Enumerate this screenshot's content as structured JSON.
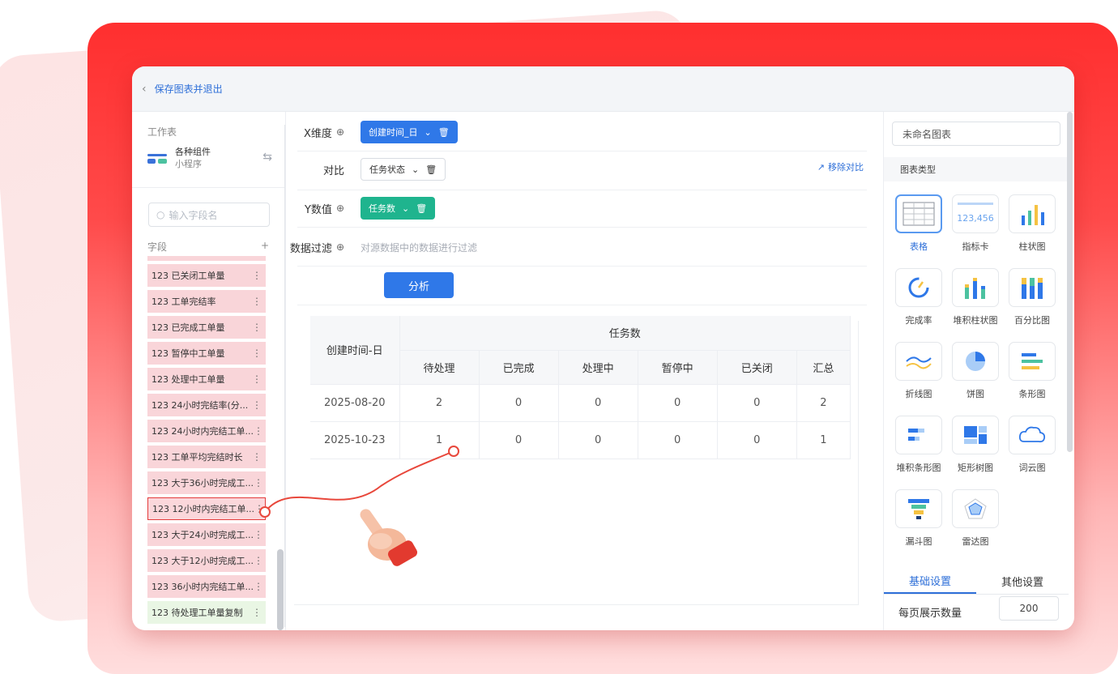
{
  "topbar": {
    "back_label": "保存图表并退出"
  },
  "left": {
    "workspace_title": "工作表",
    "workspace_name": "各种组件",
    "workspace_type": "小程序",
    "search_placeholder": "输入字段名",
    "field_header": "字段",
    "fields": [
      {
        "label": "123 已关闭工单量",
        "color": "pink"
      },
      {
        "label": "123 工单完结率",
        "color": "pink"
      },
      {
        "label": "123 已完成工单量",
        "color": "pink"
      },
      {
        "label": "123 暂停中工单量",
        "color": "pink"
      },
      {
        "label": "123 处理中工单量",
        "color": "pink"
      },
      {
        "label": "123 24小时完结率(分...",
        "color": "pink"
      },
      {
        "label": "123 24小时内完结工单...",
        "color": "pink"
      },
      {
        "label": "123 工单平均完结时长",
        "color": "pink"
      },
      {
        "label": "123 大于36小时完成工...",
        "color": "pink"
      },
      {
        "label": "123 12小时内完结工单...",
        "color": "pink",
        "selected": true
      },
      {
        "label": "123 大于24小时完成工...",
        "color": "pink"
      },
      {
        "label": "123 大于12小时完成工...",
        "color": "pink"
      },
      {
        "label": "123 36小时内完结工单...",
        "color": "pink"
      },
      {
        "label": "123 待处理工单量复制",
        "color": "green"
      }
    ]
  },
  "center": {
    "x_label": "X维度",
    "x_chip": "创建时间_日",
    "compare_label": "对比",
    "compare_chip": "任务状态",
    "remove_compare": "移除对比",
    "y_label": "Y数值",
    "y_chip": "任务数",
    "filter_label": "数据过滤",
    "filter_hint": "对源数据中的数据进行过滤",
    "analyze_button": "分析",
    "table": {
      "row_header": "创建时间-日",
      "group_header": "任务数",
      "columns": [
        "待处理",
        "已完成",
        "处理中",
        "暂停中",
        "已关闭",
        "汇总"
      ],
      "rows": [
        {
          "date": "2025-08-20",
          "values": [
            "2",
            "0",
            "0",
            "0",
            "0",
            "2"
          ]
        },
        {
          "date": "2025-10-23",
          "values": [
            "1",
            "0",
            "0",
            "0",
            "0",
            "1"
          ]
        }
      ]
    }
  },
  "right": {
    "chart_name": "未命名图表",
    "type_title": "图表类型",
    "kpi_preview": "123,456",
    "types": [
      "表格",
      "指标卡",
      "柱状图",
      "完成率",
      "堆积柱状图",
      "百分比图",
      "折线图",
      "饼图",
      "条形图",
      "堆积条形图",
      "矩形树图",
      "词云图",
      "漏斗图",
      "雷达图"
    ],
    "active_type": "表格",
    "tab_basic": "基础设置",
    "tab_other": "其他设置",
    "perpage_label": "每页展示数量",
    "perpage_value": "200"
  },
  "colors": {
    "accent": "#2f78e8",
    "green": "#1fb48e",
    "brand_red": "#ff3333"
  }
}
